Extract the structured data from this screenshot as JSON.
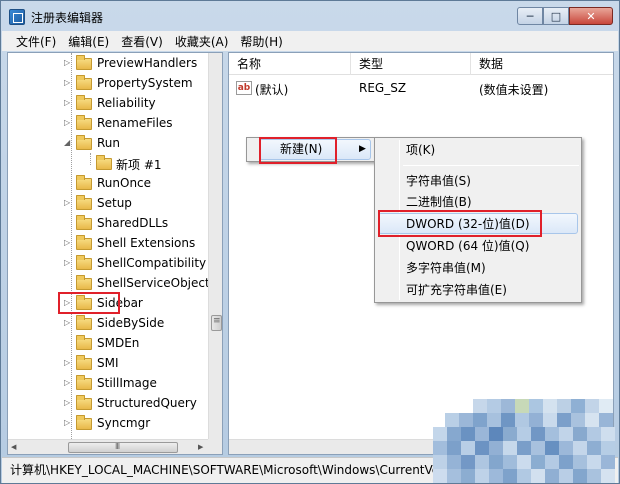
{
  "window": {
    "title": "注册表编辑器",
    "buttons": {
      "minimize": "─",
      "maximize": "□",
      "close": "✕"
    }
  },
  "menu": [
    "文件(F)",
    "编辑(E)",
    "查看(V)",
    "收藏夹(A)",
    "帮助(H)"
  ],
  "tree": {
    "items": [
      {
        "label": "PreviewHandlers",
        "expander": "▷"
      },
      {
        "label": "PropertySystem",
        "expander": "▷"
      },
      {
        "label": "Reliability",
        "expander": "▷"
      },
      {
        "label": "RenameFiles",
        "expander": "▷"
      },
      {
        "label": "Run",
        "expander": "◢"
      },
      {
        "label": "新项 #1",
        "expander": ""
      },
      {
        "label": "RunOnce",
        "expander": ""
      },
      {
        "label": "Setup",
        "expander": "▷"
      },
      {
        "label": "SharedDLLs",
        "expander": ""
      },
      {
        "label": "Shell Extensions",
        "expander": "▷"
      },
      {
        "label": "ShellCompatibility",
        "expander": "▷"
      },
      {
        "label": "ShellServiceObjectD",
        "expander": ""
      },
      {
        "label": "Sidebar",
        "expander": "▷"
      },
      {
        "label": "SideBySide",
        "expander": "▷"
      },
      {
        "label": "SMDEn",
        "expander": ""
      },
      {
        "label": "SMI",
        "expander": "▷"
      },
      {
        "label": "StillImage",
        "expander": "▷"
      },
      {
        "label": "StructuredQuery",
        "expander": "▷"
      },
      {
        "label": "Syncmgr",
        "expander": "▷"
      }
    ]
  },
  "list": {
    "headers": {
      "name": "名称",
      "type": "类型",
      "data": "数据"
    },
    "rows": [
      {
        "icon": "ab",
        "name": "(默认)",
        "type": "REG_SZ",
        "data": "(数值未设置)"
      }
    ]
  },
  "context_menu": {
    "new_label": "新建(N)",
    "submenu_arrow": "▶"
  },
  "submenu": {
    "items": [
      "项(K)",
      "字符串值(S)",
      "二进制值(B)",
      "DWORD (32-位)值(D)",
      "QWORD (64 位)值(Q)",
      "多字符串值(M)",
      "可扩充字符串值(E)"
    ]
  },
  "statusbar": {
    "path": "计算机\\HKEY_LOCAL_MACHINE\\SOFTWARE\\Microsoft\\Windows\\CurrentVe"
  },
  "colors": {
    "highlight": "#e0202a",
    "selection": "#dbe8f8"
  }
}
